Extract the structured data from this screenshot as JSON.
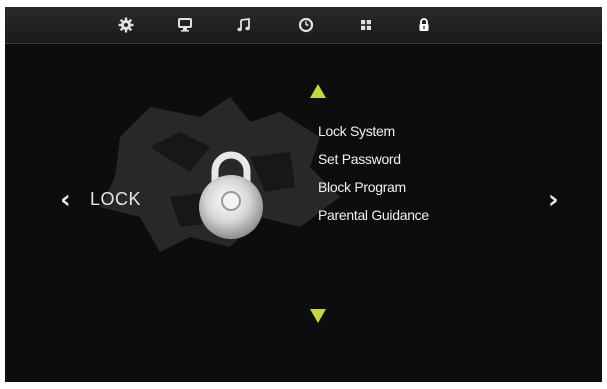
{
  "topbar": {
    "tabs": [
      {
        "icon": "gear-icon",
        "label": "Setup"
      },
      {
        "icon": "monitor-icon",
        "label": "Picture"
      },
      {
        "icon": "music-note-icon",
        "label": "Sound"
      },
      {
        "icon": "clock-icon",
        "label": "Time"
      },
      {
        "icon": "grid-icon",
        "label": "Options"
      },
      {
        "icon": "lock-icon",
        "label": "Lock"
      }
    ],
    "active_color": "#ffffff",
    "icon_color": "#e0e0e0"
  },
  "section": {
    "title": "LOCK"
  },
  "menu": {
    "items": [
      {
        "label": "Lock System"
      },
      {
        "label": "Set Password"
      },
      {
        "label": "Block Program"
      },
      {
        "label": "Parental Guidance"
      }
    ]
  },
  "colors": {
    "background": "#0d0d0e",
    "accent_arrow": "#c8d63a",
    "text": "#f0f0f0"
  },
  "nav": {
    "left_arrow": "‹",
    "right_arrow": "›"
  }
}
